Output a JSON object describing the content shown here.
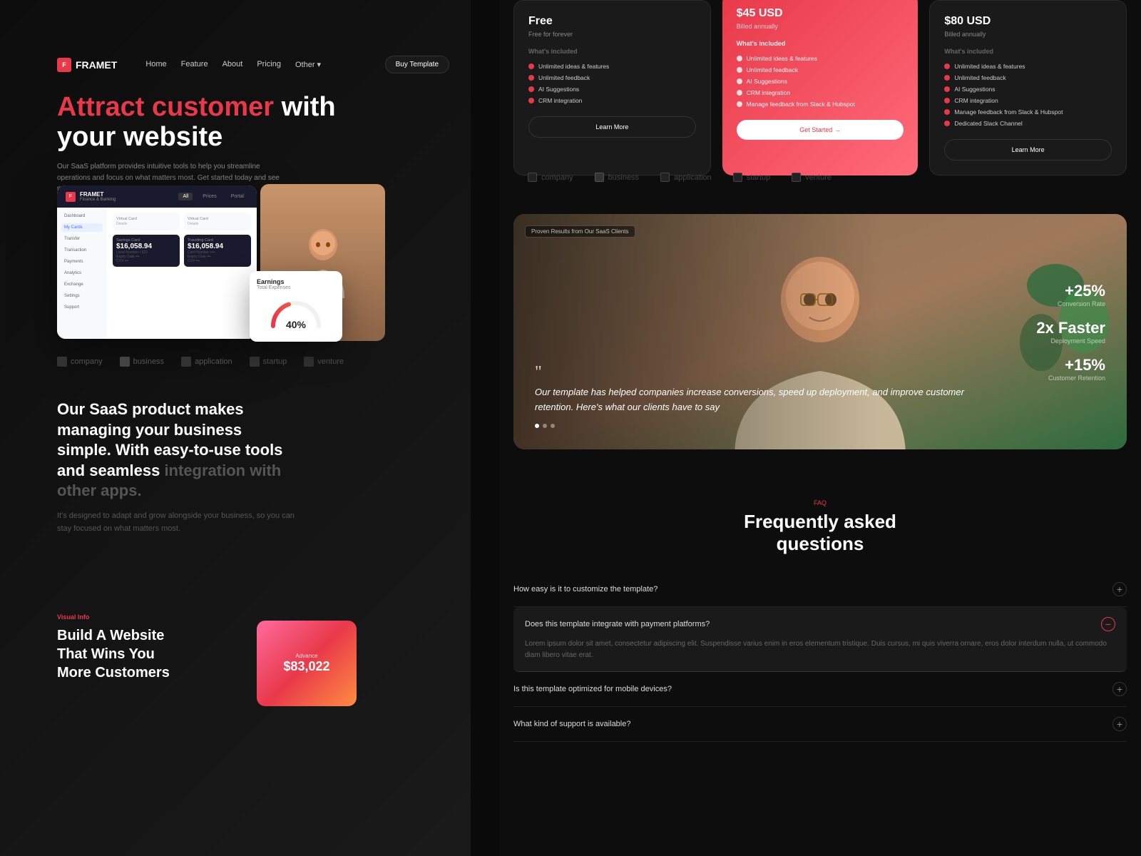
{
  "brand": {
    "name": "FRAMET",
    "logo_text": "F"
  },
  "nav": {
    "links": [
      "Home",
      "Feature",
      "About",
      "Pricing",
      "Other"
    ],
    "buy_label": "Buy Template"
  },
  "hero": {
    "title_highlight": "Attract customer",
    "title_rest": " with your website",
    "subtitle": "Our SaaS platform provides intuitive tools to help you streamline operations and focus on what matters most. Get started today and see the difference.",
    "btn_learn": "Learn More",
    "btn_started": "Get Started →"
  },
  "brands": [
    "company",
    "business",
    "application",
    "startup",
    "venture"
  ],
  "saas_section": {
    "heading_part1": "Our SaaS product makes managing your ",
    "heading_highlight": "business",
    "heading_part2": " simple. With easy-to-use tools and seamless ",
    "heading_dim": "integration with other apps.",
    "subtext": "It's designed to adapt and grow alongside your business, so you can stay focused on what matters most."
  },
  "build_section": {
    "tag": "Visual Info",
    "title": "Build A Website\nThat Wins You\nMore Customers",
    "card_label": "Advance",
    "card_value": "$83,022"
  },
  "pricing": {
    "plans": [
      {
        "name": "Free",
        "desc": "Free for forever",
        "amount": "",
        "billing": "",
        "featured": false,
        "features": [
          "Unlimited ideas & features",
          "Unlimited feedback",
          "AI Suggestions",
          "CRM integration"
        ],
        "btn_label": "Learn More"
      },
      {
        "name": "$45 USD",
        "desc": "Billed annually",
        "amount": "$45 USD",
        "billing": "Billed annually",
        "featured": true,
        "features": [
          "Unlimited ideas & features",
          "Unlimited feedback",
          "AI Suggestions",
          "CRM integration",
          "Manage feedback from Slack & Hubspot"
        ],
        "btn_label": "Get Started →"
      },
      {
        "name": "$80 USD",
        "desc": "Billed annually",
        "amount": "$80 USD",
        "billing": "Billed annually",
        "featured": false,
        "features": [
          "Unlimited ideas & features",
          "Unlimited feedback",
          "AI Suggestions",
          "CRM integration",
          "Manage feedback from Slack & Hubspot",
          "Dedicated Slack Channel"
        ],
        "btn_label": "Learn More"
      }
    ]
  },
  "testimonial": {
    "tag": "Proven Results from Our SaaS Clients",
    "quote": "Our template has helped companies increase conversions, speed up deployment, and improve customer retention. Here's what our clients have to say",
    "stats": [
      {
        "value": "+25%",
        "label": "Conversion Rate"
      },
      {
        "value": "2x Faster",
        "label": "Deployment Speed"
      },
      {
        "value": "+15%",
        "label": "Customer Retention"
      }
    ]
  },
  "faq": {
    "tag": "FAQ",
    "title": "Frequently asked\nquestions",
    "items": [
      {
        "question": "How easy is it to customize the template?",
        "answer": "",
        "expanded": false
      },
      {
        "question": "Does this template integrate with payment platforms?",
        "answer": "Lorem ipsum dolor sit amet, consectetur adipiscing elit. Suspendisse varius enim in eros elementum tristique. Duis cursus, mi quis viverra ornare, eros dolor interdum nulla, ut commodo diam libero vitae erat.",
        "expanded": true
      },
      {
        "question": "Is this template optimized for mobile devices?",
        "answer": "",
        "expanded": false
      },
      {
        "question": "What kind of support is available?",
        "answer": "",
        "expanded": false
      }
    ]
  },
  "dashboard": {
    "title": "FRAMET",
    "subtitle": "Finance & Banking",
    "tabs": [
      "All",
      "Prices",
      "Portal"
    ],
    "sidebar_items": [
      "Dashboard",
      "My Cards",
      "Transfer",
      "Transaction",
      "Payments",
      "Analytics",
      "Exchange",
      "Settings",
      "Support"
    ],
    "cards": [
      {
        "label": "Savings Card",
        "value": "$16,058.94",
        "sub": ""
      },
      {
        "label": "Traveling Card",
        "value": "$16,058.94",
        "sub": ""
      }
    ]
  },
  "earnings": {
    "title": "Earnings",
    "subtitle": "Total Expenses",
    "percent": "40%"
  }
}
